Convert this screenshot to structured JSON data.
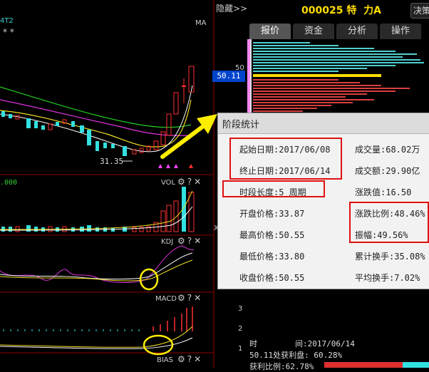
{
  "header": {
    "hide_label": "隐藏>>",
    "stock_code": "000025",
    "stock_name": "特  力A",
    "decide_label": "决策"
  },
  "tabs": [
    {
      "label": "报价"
    },
    {
      "label": "资金"
    },
    {
      "label": "分析"
    },
    {
      "label": "操作"
    }
  ],
  "chart": {
    "ma_label": "MA",
    "left_partial_label": "4T2",
    "asterisks": "* *",
    "price_tag": "50.11",
    "axis_50": "50",
    "low_marker": "31.35",
    "vol_left_value": ".000",
    "vol_label": "VOL",
    "kdj_label": "KDJ",
    "macd_label": "MACD",
    "bias_label": "BIAS",
    "macd_axis_3": "3",
    "macd_axis_2": "2",
    "macd_axis_1": "1",
    "x_marker": "X"
  },
  "popup": {
    "title": "阶段统计",
    "start_date": "起始日期:2017/06/08",
    "end_date": "终止日期:2017/06/14",
    "length": "时段长度:5  周期",
    "open_price": "开盘价格:33.87",
    "high_price": "最高价格:50.55",
    "low_price": "最低价格:33.80",
    "close_price": "收盘价格:50.55",
    "volume": "成交量:68.02万",
    "amount": "成交额:29.90亿",
    "change_value": "涨跌值:16.50",
    "change_ratio": "涨跌比例:48.46%",
    "amplitude": "振幅:49.56%",
    "cum_turnover": "累计换手:35.08%",
    "avg_turnover": "平均换手:7.02%"
  },
  "bottom": {
    "time_line": "时        间:2017/06/14",
    "profit_line": "50.11处获利盘: 60.28%",
    "ratio_line": "获利比例:62.78%"
  },
  "colors": {
    "up": "#ff3030",
    "down": "#33e0e0",
    "highlight": "#ffee00",
    "accent_box": "#e01010"
  }
}
